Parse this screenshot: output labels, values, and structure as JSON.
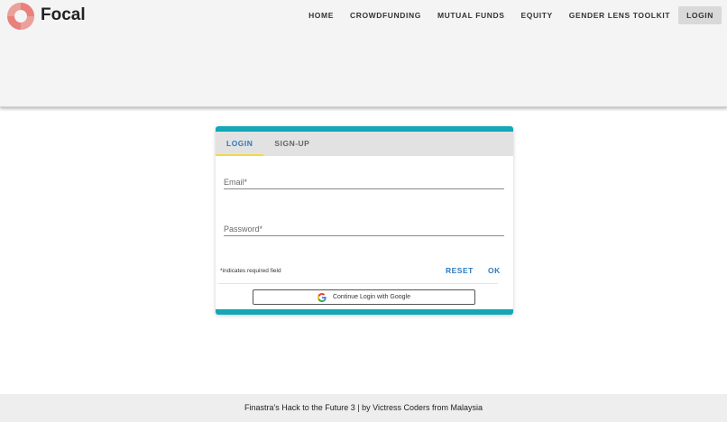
{
  "header": {
    "brand": "Focal",
    "logo_icon": "lifebuoy-logo-icon",
    "nav": [
      {
        "label": "HOME"
      },
      {
        "label": "CROWDFUNDING"
      },
      {
        "label": "MUTUAL FUNDS"
      },
      {
        "label": "EQUITY"
      },
      {
        "label": "GENDER LENS TOOLKIT"
      },
      {
        "label": "LOGIN",
        "active": true
      }
    ]
  },
  "login_card": {
    "tabs": [
      {
        "label": "LOGIN",
        "active": true
      },
      {
        "label": "SIGN-UP",
        "active": false
      }
    ],
    "email": {
      "placeholder": "Email*",
      "value": ""
    },
    "password": {
      "placeholder": "Password*",
      "value": ""
    },
    "required_note": "*indicates required field",
    "reset_label": "RESET",
    "ok_label": "OK",
    "google_button_label": "Continue Login with Google",
    "google_icon": "google-g-icon"
  },
  "footer": {
    "text": "Finastra's Hack to the Future 3 | by Victress Coders from Malaysia"
  },
  "colors": {
    "accent": "#14a7b6",
    "link": "#2b7bbd",
    "tab_indicator": "#f3d84a",
    "logo": "#e8817c"
  }
}
